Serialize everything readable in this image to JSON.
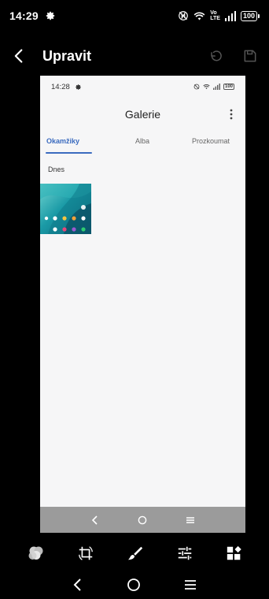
{
  "status_bar": {
    "time": "14:29",
    "battery": "100",
    "network_top": "Vo",
    "network_bottom": "LTE"
  },
  "header": {
    "title": "Upravit"
  },
  "preview": {
    "status_bar": {
      "time": "14:28",
      "battery": "100"
    },
    "title": "Galerie",
    "tabs": [
      {
        "label": "Okamžiky",
        "active": true
      },
      {
        "label": "Alba",
        "active": false
      },
      {
        "label": "Prozkoumat",
        "active": false
      }
    ],
    "section_label": "Dnes"
  },
  "tools": [
    "filters-icon",
    "crop-rotate-icon",
    "brush-icon",
    "adjust-icon",
    "more-tools-icon"
  ],
  "colors": {
    "accent": "#3b6bbf",
    "preview_bg": "#f6f6f7",
    "preview_nav": "#9b9b9b"
  }
}
